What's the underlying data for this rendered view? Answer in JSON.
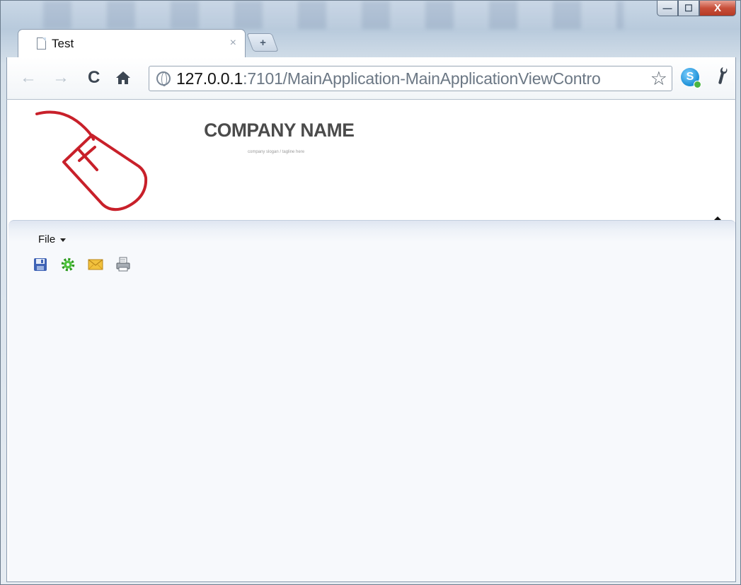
{
  "browser": {
    "tab_title": "Test",
    "tab_close": "×",
    "new_tab": "+",
    "url_host": "127.0.0.1",
    "url_rest": ":7101/MainApplication-MainApplicationViewContro",
    "window_controls": {
      "minimize": "—",
      "maximize": "☐",
      "close": "X"
    }
  },
  "header": {
    "company_name": "COMPANY NAME",
    "slogan": "company slogan / tagline here"
  },
  "app": {
    "menu": {
      "file_label": "File"
    },
    "toolbar_icons": [
      "save-icon",
      "settings-icon",
      "email-icon",
      "print-icon"
    ]
  },
  "colors": {
    "logo_red": "#c8202a",
    "panel_bg": "#f7f9fc"
  }
}
